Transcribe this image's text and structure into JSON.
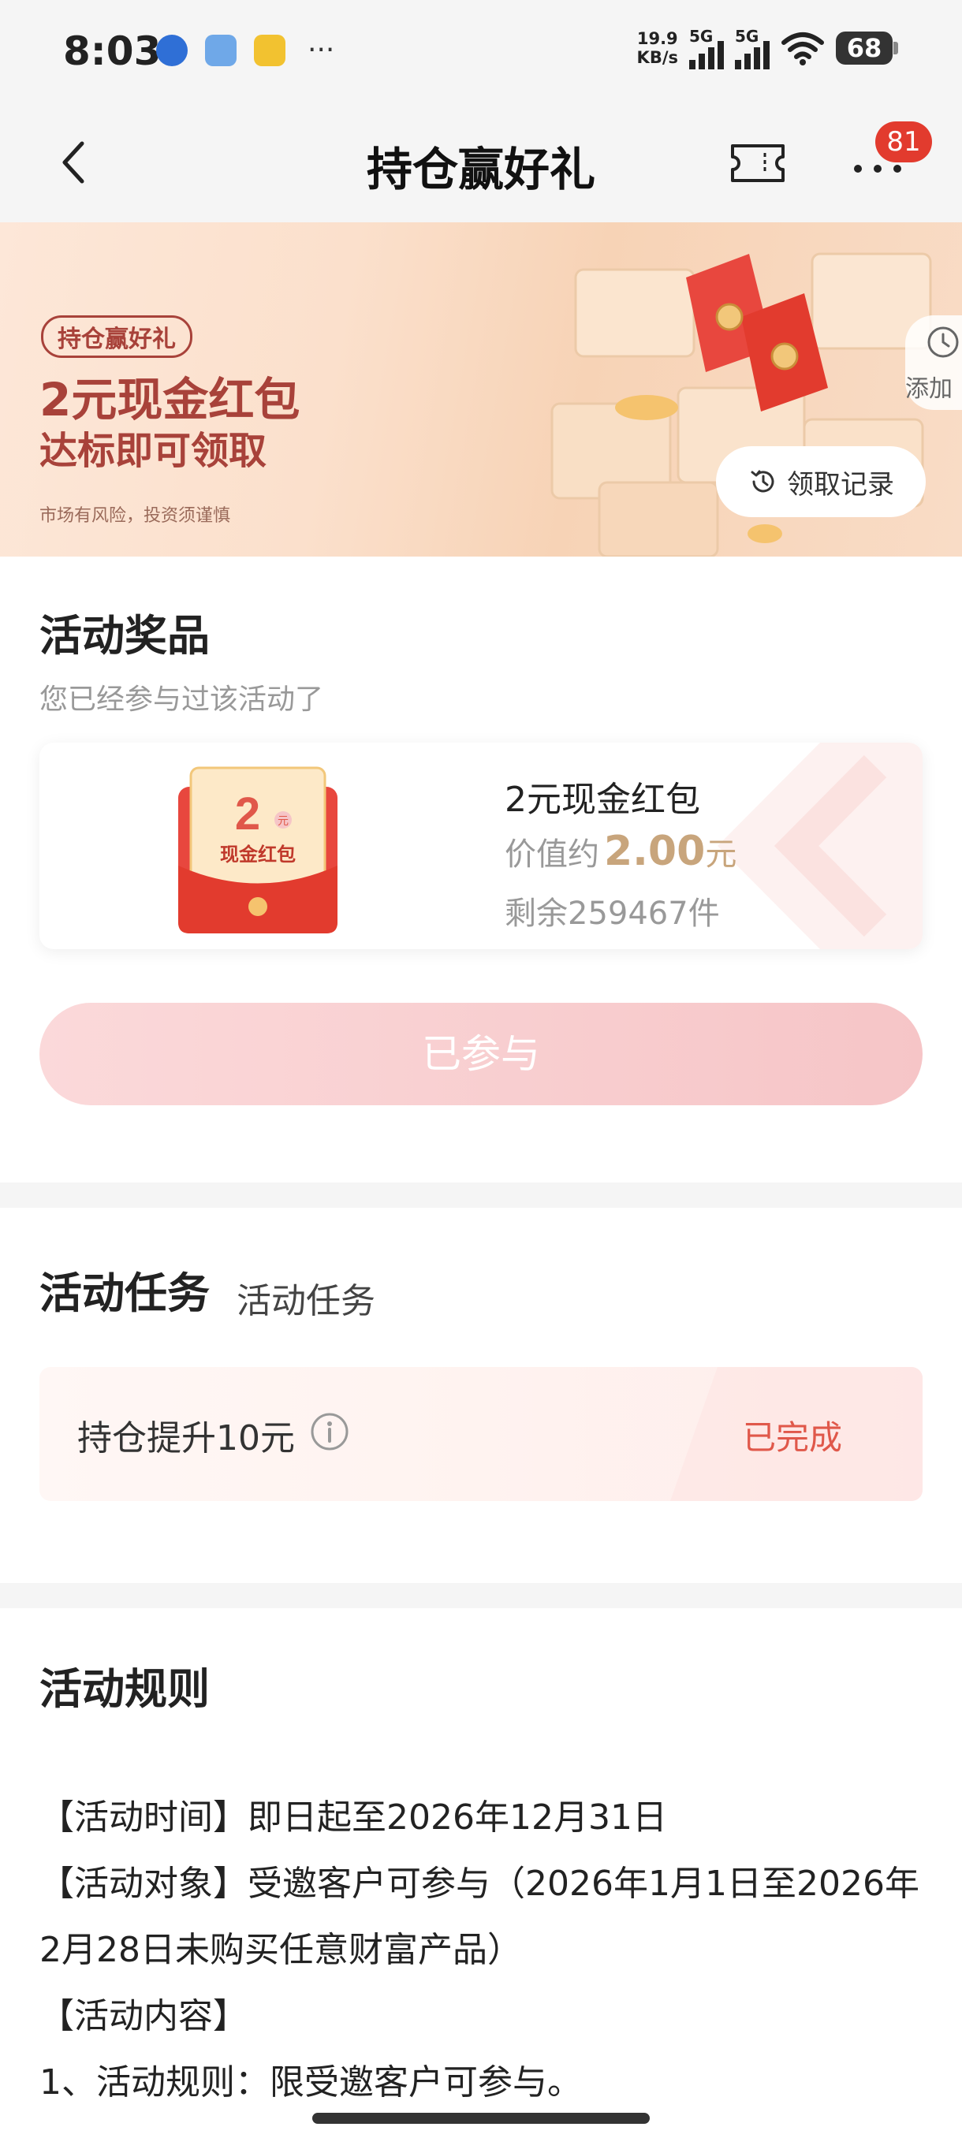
{
  "status_bar": {
    "time": "8:03",
    "net_speed_value": "19.9",
    "net_speed_unit": "KB/s",
    "signal_1": "5G",
    "signal_2": "5G",
    "battery": "68",
    "overflow": "···"
  },
  "nav": {
    "title": "持仓赢好礼",
    "badge": "81"
  },
  "banner": {
    "tag": "持仓赢好礼",
    "headline": "2元现金红包",
    "subheadline": "达标即可领取",
    "disclaimer": "市场有风险，投资须谨慎",
    "add_label": "添加",
    "record_button": "领取记录"
  },
  "prize": {
    "section_title": "活动奖品",
    "subtitle": "您已经参与过该活动了",
    "envelope_amount": "2",
    "envelope_unit": "元",
    "envelope_text": "现金红包",
    "name": "2元现金红包",
    "value_prefix": "价值约",
    "value_amount": "2.00",
    "value_unit": "元",
    "stock": "剩余259467件",
    "button": "已参与"
  },
  "tasks": {
    "section_title": "活动任务",
    "subtitle": "活动任务",
    "items": [
      {
        "label": "持仓提升10元",
        "status": "已完成"
      }
    ]
  },
  "rules": {
    "section_title": "活动规则",
    "lines": [
      "【活动时间】即日起至2026年12月31日",
      "【活动对象】受邀客户可参与（2026年1月1日至2026年2月28日未购买任意财富产品）",
      "【活动内容】",
      "1、活动规则：限受邀客户可参与。"
    ]
  },
  "colors": {
    "accent": "#a8423a",
    "status_done": "#e0584a",
    "button_disabled": "#f6c5c7",
    "badge": "#e23b2e",
    "value_gold": "#c8a57c"
  },
  "icons": [
    "back-icon",
    "ticket-icon",
    "more-icon",
    "add-icon",
    "history-icon",
    "info-icon",
    "wifi-icon"
  ]
}
